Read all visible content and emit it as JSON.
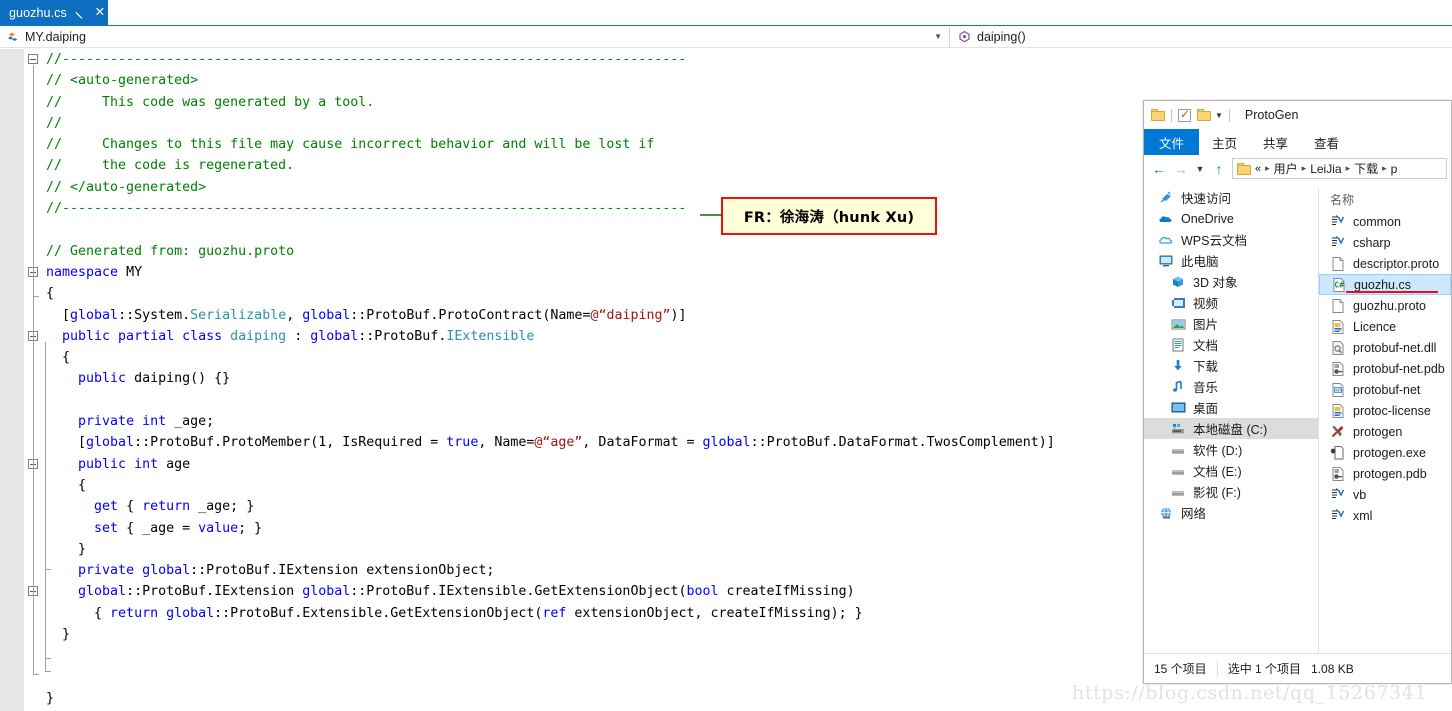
{
  "editor": {
    "tab": {
      "title": "guozhu.cs",
      "pin_icon": "pin-icon",
      "close_icon": "close-icon"
    },
    "navbar": {
      "scope_icon": "class-icon",
      "scope": "MY.daiping",
      "caret_icon": "chevron-down-icon",
      "member_icon": "method-icon",
      "member": "daiping()"
    },
    "lines": [
      {
        "indent": 0,
        "fold": true,
        "tokens": [
          {
            "t": "//------------------------------------------------------------------------------",
            "c": "cmt"
          }
        ]
      },
      {
        "indent": 1,
        "fold": false,
        "tokens": [
          {
            "t": "// <auto-generated>",
            "c": "cmt"
          }
        ]
      },
      {
        "indent": 1,
        "fold": false,
        "tokens": [
          {
            "t": "//     This code was generated by a tool.",
            "c": "cmt"
          }
        ]
      },
      {
        "indent": 1,
        "fold": false,
        "tokens": [
          {
            "t": "//",
            "c": "cmt"
          }
        ]
      },
      {
        "indent": 1,
        "fold": false,
        "tokens": [
          {
            "t": "//     Changes to this file may cause incorrect behavior and will be lost if",
            "c": "cmt"
          }
        ]
      },
      {
        "indent": 1,
        "fold": false,
        "tokens": [
          {
            "t": "//     the code is regenerated.",
            "c": "cmt"
          }
        ]
      },
      {
        "indent": 1,
        "fold": false,
        "tokens": [
          {
            "t": "// </auto-generated>",
            "c": "cmt"
          }
        ]
      },
      {
        "indent": 1,
        "fold": false,
        "tokens": [
          {
            "t": "//------------------------------------------------------------------------------",
            "c": "cmt"
          }
        ]
      },
      {
        "indent": 1,
        "fold": false,
        "tokens": [
          {
            "t": "",
            "c": "txt"
          }
        ]
      },
      {
        "indent": 1,
        "fold": false,
        "tokens": [
          {
            "t": "// Generated from: guozhu.proto",
            "c": "cmt"
          }
        ]
      },
      {
        "indent": 0,
        "fold": true,
        "tokens": [
          {
            "t": "namespace",
            "c": "kw"
          },
          {
            "t": " MY",
            "c": "txt"
          }
        ]
      },
      {
        "indent": 1,
        "fold": false,
        "tokens": [
          {
            "t": "{",
            "c": "txt"
          }
        ]
      },
      {
        "indent": 1,
        "fold": false,
        "tokens": [
          {
            "t": "  [",
            "c": "txt"
          },
          {
            "t": "global",
            "c": "kw"
          },
          {
            "t": "::System.",
            "c": "txt"
          },
          {
            "t": "Serializable",
            "c": "type"
          },
          {
            "t": ", ",
            "c": "txt"
          },
          {
            "t": "global",
            "c": "kw"
          },
          {
            "t": "::ProtoBuf.ProtoContract(Name=",
            "c": "txt"
          },
          {
            "t": "@“daiping”",
            "c": "str"
          },
          {
            "t": ")]",
            "c": "txt"
          }
        ]
      },
      {
        "indent": 0,
        "fold": true,
        "tokens": [
          {
            "t": "  ",
            "c": "txt"
          },
          {
            "t": "public partial class",
            "c": "kw"
          },
          {
            "t": " ",
            "c": "txt"
          },
          {
            "t": "daiping",
            "c": "type"
          },
          {
            "t": " : ",
            "c": "txt"
          },
          {
            "t": "global",
            "c": "kw"
          },
          {
            "t": "::ProtoBuf.",
            "c": "txt"
          },
          {
            "t": "IExtensible",
            "c": "type"
          }
        ]
      },
      {
        "indent": 1,
        "fold": false,
        "tokens": [
          {
            "t": "  {",
            "c": "txt"
          }
        ]
      },
      {
        "indent": 1,
        "fold": false,
        "tokens": [
          {
            "t": "    ",
            "c": "txt"
          },
          {
            "t": "public",
            "c": "kw"
          },
          {
            "t": " daiping() {}",
            "c": "txt"
          }
        ]
      },
      {
        "indent": 1,
        "fold": false,
        "tokens": [
          {
            "t": "",
            "c": "txt"
          }
        ]
      },
      {
        "indent": 1,
        "fold": false,
        "tokens": [
          {
            "t": "    ",
            "c": "txt"
          },
          {
            "t": "private int",
            "c": "kw"
          },
          {
            "t": " _age;",
            "c": "txt"
          }
        ]
      },
      {
        "indent": 1,
        "fold": false,
        "tokens": [
          {
            "t": "    [",
            "c": "txt"
          },
          {
            "t": "global",
            "c": "kw"
          },
          {
            "t": "::ProtoBuf.ProtoMember(1, IsRequired = ",
            "c": "txt"
          },
          {
            "t": "true",
            "c": "kw"
          },
          {
            "t": ", Name=",
            "c": "txt"
          },
          {
            "t": "@“age”",
            "c": "str"
          },
          {
            "t": ", DataFormat = ",
            "c": "txt"
          },
          {
            "t": "global",
            "c": "kw"
          },
          {
            "t": "::ProtoBuf.DataFormat.TwosComplement)]",
            "c": "txt"
          }
        ]
      },
      {
        "indent": 0,
        "fold": true,
        "tokens": [
          {
            "t": "    ",
            "c": "txt"
          },
          {
            "t": "public int",
            "c": "kw"
          },
          {
            "t": " age",
            "c": "txt"
          }
        ]
      },
      {
        "indent": 1,
        "fold": false,
        "tokens": [
          {
            "t": "    {",
            "c": "txt"
          }
        ]
      },
      {
        "indent": 1,
        "fold": false,
        "tokens": [
          {
            "t": "      ",
            "c": "txt"
          },
          {
            "t": "get",
            "c": "kw"
          },
          {
            "t": " { ",
            "c": "txt"
          },
          {
            "t": "return",
            "c": "kw"
          },
          {
            "t": " _age; }",
            "c": "txt"
          }
        ]
      },
      {
        "indent": 1,
        "fold": false,
        "tokens": [
          {
            "t": "      ",
            "c": "txt"
          },
          {
            "t": "set",
            "c": "kw"
          },
          {
            "t": " { _age = ",
            "c": "txt"
          },
          {
            "t": "value",
            "c": "kw"
          },
          {
            "t": "; }",
            "c": "txt"
          }
        ]
      },
      {
        "indent": 1,
        "fold": false,
        "tokens": [
          {
            "t": "    }",
            "c": "txt"
          }
        ]
      },
      {
        "indent": 1,
        "fold": false,
        "tokens": [
          {
            "t": "    ",
            "c": "txt"
          },
          {
            "t": "private",
            "c": "kw"
          },
          {
            "t": " ",
            "c": "txt"
          },
          {
            "t": "global",
            "c": "kw"
          },
          {
            "t": "::ProtoBuf.IExtension extensionObject;",
            "c": "txt"
          }
        ]
      },
      {
        "indent": 0,
        "fold": true,
        "tokens": [
          {
            "t": "    ",
            "c": "txt"
          },
          {
            "t": "global",
            "c": "kw"
          },
          {
            "t": "::ProtoBuf.IExtension ",
            "c": "txt"
          },
          {
            "t": "global",
            "c": "kw"
          },
          {
            "t": "::ProtoBuf.IExtensible.GetExtensionObject(",
            "c": "txt"
          },
          {
            "t": "bool",
            "c": "kw"
          },
          {
            "t": " createIfMissing)",
            "c": "txt"
          }
        ]
      },
      {
        "indent": 1,
        "fold": false,
        "tokens": [
          {
            "t": "      { ",
            "c": "txt"
          },
          {
            "t": "return",
            "c": "kw"
          },
          {
            "t": " ",
            "c": "txt"
          },
          {
            "t": "global",
            "c": "kw"
          },
          {
            "t": "::ProtoBuf.Extensible.GetExtensionObject(",
            "c": "txt"
          },
          {
            "t": "ref",
            "c": "kw"
          },
          {
            "t": " extensionObject, createIfMissing); }",
            "c": "txt"
          }
        ]
      },
      {
        "indent": 1,
        "fold": false,
        "tokens": [
          {
            "t": "  }",
            "c": "txt"
          }
        ]
      },
      {
        "indent": 1,
        "fold": false,
        "tokens": [
          {
            "t": "",
            "c": "txt"
          }
        ]
      },
      {
        "indent": 1,
        "fold": false,
        "tokens": [
          {
            "t": "",
            "c": "txt"
          }
        ]
      },
      {
        "indent": 1,
        "fold": false,
        "tokens": [
          {
            "t": "}",
            "c": "txt"
          }
        ]
      }
    ]
  },
  "annotation": {
    "text": "FR：徐海涛（hunk Xu)",
    "border_color": "#e8110f",
    "background_color": "#ffffd9"
  },
  "explorer": {
    "quick_access": {
      "folder_icon": "folder-icon",
      "properties_icon": "properties-checkbox-icon",
      "new_folder_icon": "new-folder-icon",
      "dropdown_icon": "chevron-down-icon"
    },
    "window_title": "ProtoGen",
    "ribbon_tabs": [
      {
        "label": "文件",
        "active": true
      },
      {
        "label": "主页",
        "active": false
      },
      {
        "label": "共享",
        "active": false
      },
      {
        "label": "查看",
        "active": false
      }
    ],
    "address": {
      "back_icon": "arrow-left-icon",
      "forward_icon": "arrow-right-icon",
      "recent_icon": "chevron-down-icon",
      "up_icon": "arrow-up-icon",
      "folder_icon": "folder-icon",
      "root_glyph": "«",
      "crumbs": [
        "用户",
        "LeiJia",
        "下载",
        "p"
      ]
    },
    "nav_items": [
      {
        "label": "快速访问",
        "icon": "pin-star-icon",
        "indent": false,
        "selected": false
      },
      {
        "label": "OneDrive",
        "icon": "onedrive-cloud-icon",
        "indent": false,
        "selected": false
      },
      {
        "label": "WPS云文档",
        "icon": "wps-cloud-icon",
        "indent": false,
        "selected": false
      },
      {
        "label": "此电脑",
        "icon": "this-pc-icon",
        "indent": false,
        "selected": false
      },
      {
        "label": "3D 对象",
        "icon": "3d-objects-icon",
        "indent": true,
        "selected": false
      },
      {
        "label": "视频",
        "icon": "videos-icon",
        "indent": true,
        "selected": false
      },
      {
        "label": "图片",
        "icon": "pictures-icon",
        "indent": true,
        "selected": false
      },
      {
        "label": "文档",
        "icon": "documents-icon",
        "indent": true,
        "selected": false
      },
      {
        "label": "下载",
        "icon": "downloads-icon",
        "indent": true,
        "selected": false
      },
      {
        "label": "音乐",
        "icon": "music-icon",
        "indent": true,
        "selected": false
      },
      {
        "label": "桌面",
        "icon": "desktop-icon",
        "indent": true,
        "selected": false
      },
      {
        "label": "本地磁盘 (C:)",
        "icon": "local-disk-icon",
        "indent": true,
        "selected": true
      },
      {
        "label": "软件 (D:)",
        "icon": "drive-icon",
        "indent": true,
        "selected": false
      },
      {
        "label": "文档 (E:)",
        "icon": "drive-icon",
        "indent": true,
        "selected": false
      },
      {
        "label": "影视 (F:)",
        "icon": "drive-icon",
        "indent": true,
        "selected": false
      },
      {
        "label": "网络",
        "icon": "network-icon",
        "indent": false,
        "selected": false
      }
    ],
    "column_header": "名称",
    "files": [
      {
        "name": "common",
        "icon": "script-icon",
        "selected": false
      },
      {
        "name": "csharp",
        "icon": "script-icon",
        "selected": false
      },
      {
        "name": "descriptor.proto",
        "icon": "blank-file-icon",
        "selected": false
      },
      {
        "name": "guozhu.cs",
        "icon": "csharp-file-icon",
        "selected": true
      },
      {
        "name": "guozhu.proto",
        "icon": "blank-file-icon",
        "selected": false
      },
      {
        "name": "Licence",
        "icon": "text-file-icon",
        "selected": false
      },
      {
        "name": "protobuf-net.dll",
        "icon": "dll-file-icon",
        "selected": false
      },
      {
        "name": "protobuf-net.pdb",
        "icon": "pdb-file-icon",
        "selected": false
      },
      {
        "name": "protobuf-net",
        "icon": "xml-config-icon",
        "selected": false
      },
      {
        "name": "protoc-license",
        "icon": "text-file-icon",
        "selected": false
      },
      {
        "name": "protogen",
        "icon": "tools-icon",
        "selected": false
      },
      {
        "name": "protogen.exe",
        "icon": "exe-config-icon",
        "selected": false
      },
      {
        "name": "protogen.pdb",
        "icon": "pdb-file-icon",
        "selected": false
      },
      {
        "name": "vb",
        "icon": "script-icon",
        "selected": false
      },
      {
        "name": "xml",
        "icon": "script-icon",
        "selected": false
      }
    ],
    "status": {
      "count": "15 个项目",
      "selection": "选中 1 个项目",
      "size": "1.08 KB"
    }
  },
  "watermark": "https://blog.csdn.net/qq_15267341"
}
